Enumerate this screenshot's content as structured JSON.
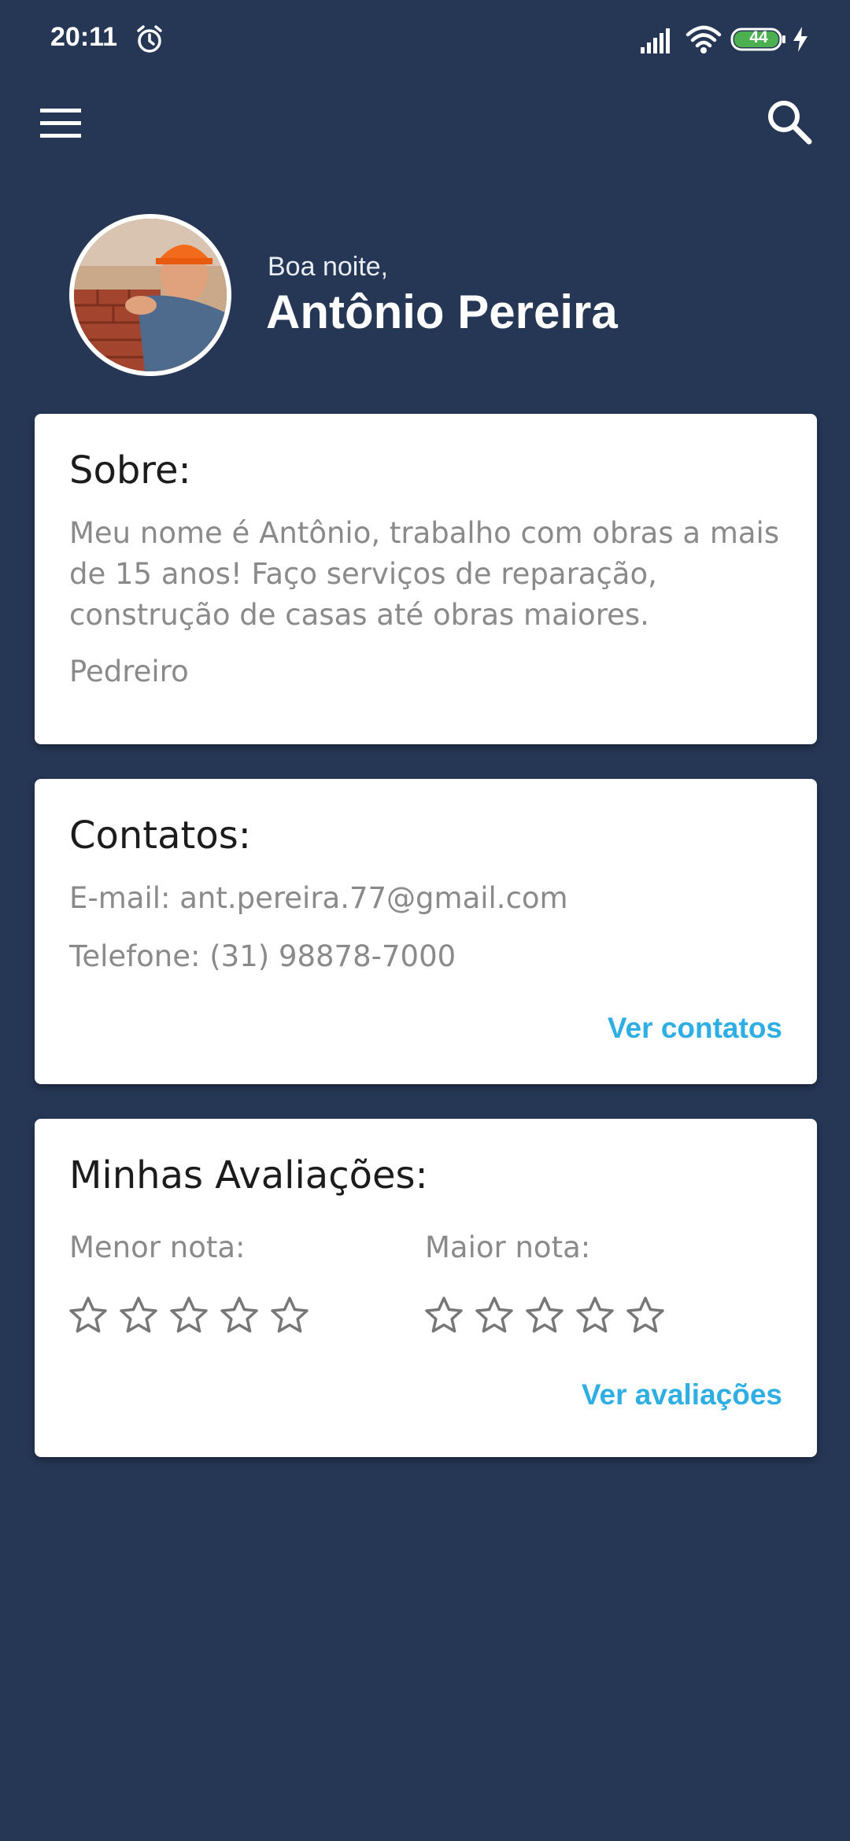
{
  "status_bar": {
    "time": "20:11",
    "battery_level": "44",
    "icons": [
      "alarm-icon",
      "signal-icon",
      "wifi-icon",
      "battery-icon",
      "charging-bolt-icon"
    ]
  },
  "app_bar": {
    "icons": [
      "menu-icon",
      "search-icon"
    ]
  },
  "profile": {
    "greeting": "Boa noite,",
    "name": "Antônio Pereira",
    "avatar_icon": "avatar-photo"
  },
  "about": {
    "title": "Sobre:",
    "description_lines": [
      "Meu nome é Antônio, trabalho com obras a mais",
      "de 15 anos! Faço serviços de reparação,",
      "construção de casas até obras maiores."
    ],
    "profession": "Pedreiro"
  },
  "contacts": {
    "title": "Contatos:",
    "email": "E-mail: ant.pereira.77@gmail.com",
    "phone": "Telefone: (31) 98878-7000",
    "link": "Ver contatos"
  },
  "ratings": {
    "title": "Minhas Avaliações:",
    "lowest_label": "Menor nota:",
    "highest_label": "Maior nota:",
    "lowest_stars": 0,
    "highest_stars": 0,
    "max_stars": 5,
    "link": "Ver avaliações"
  },
  "colors": {
    "background": "#263756",
    "accent_link": "#2eaee2",
    "card": "#ffffff",
    "muted_text": "#8a8a8a"
  }
}
